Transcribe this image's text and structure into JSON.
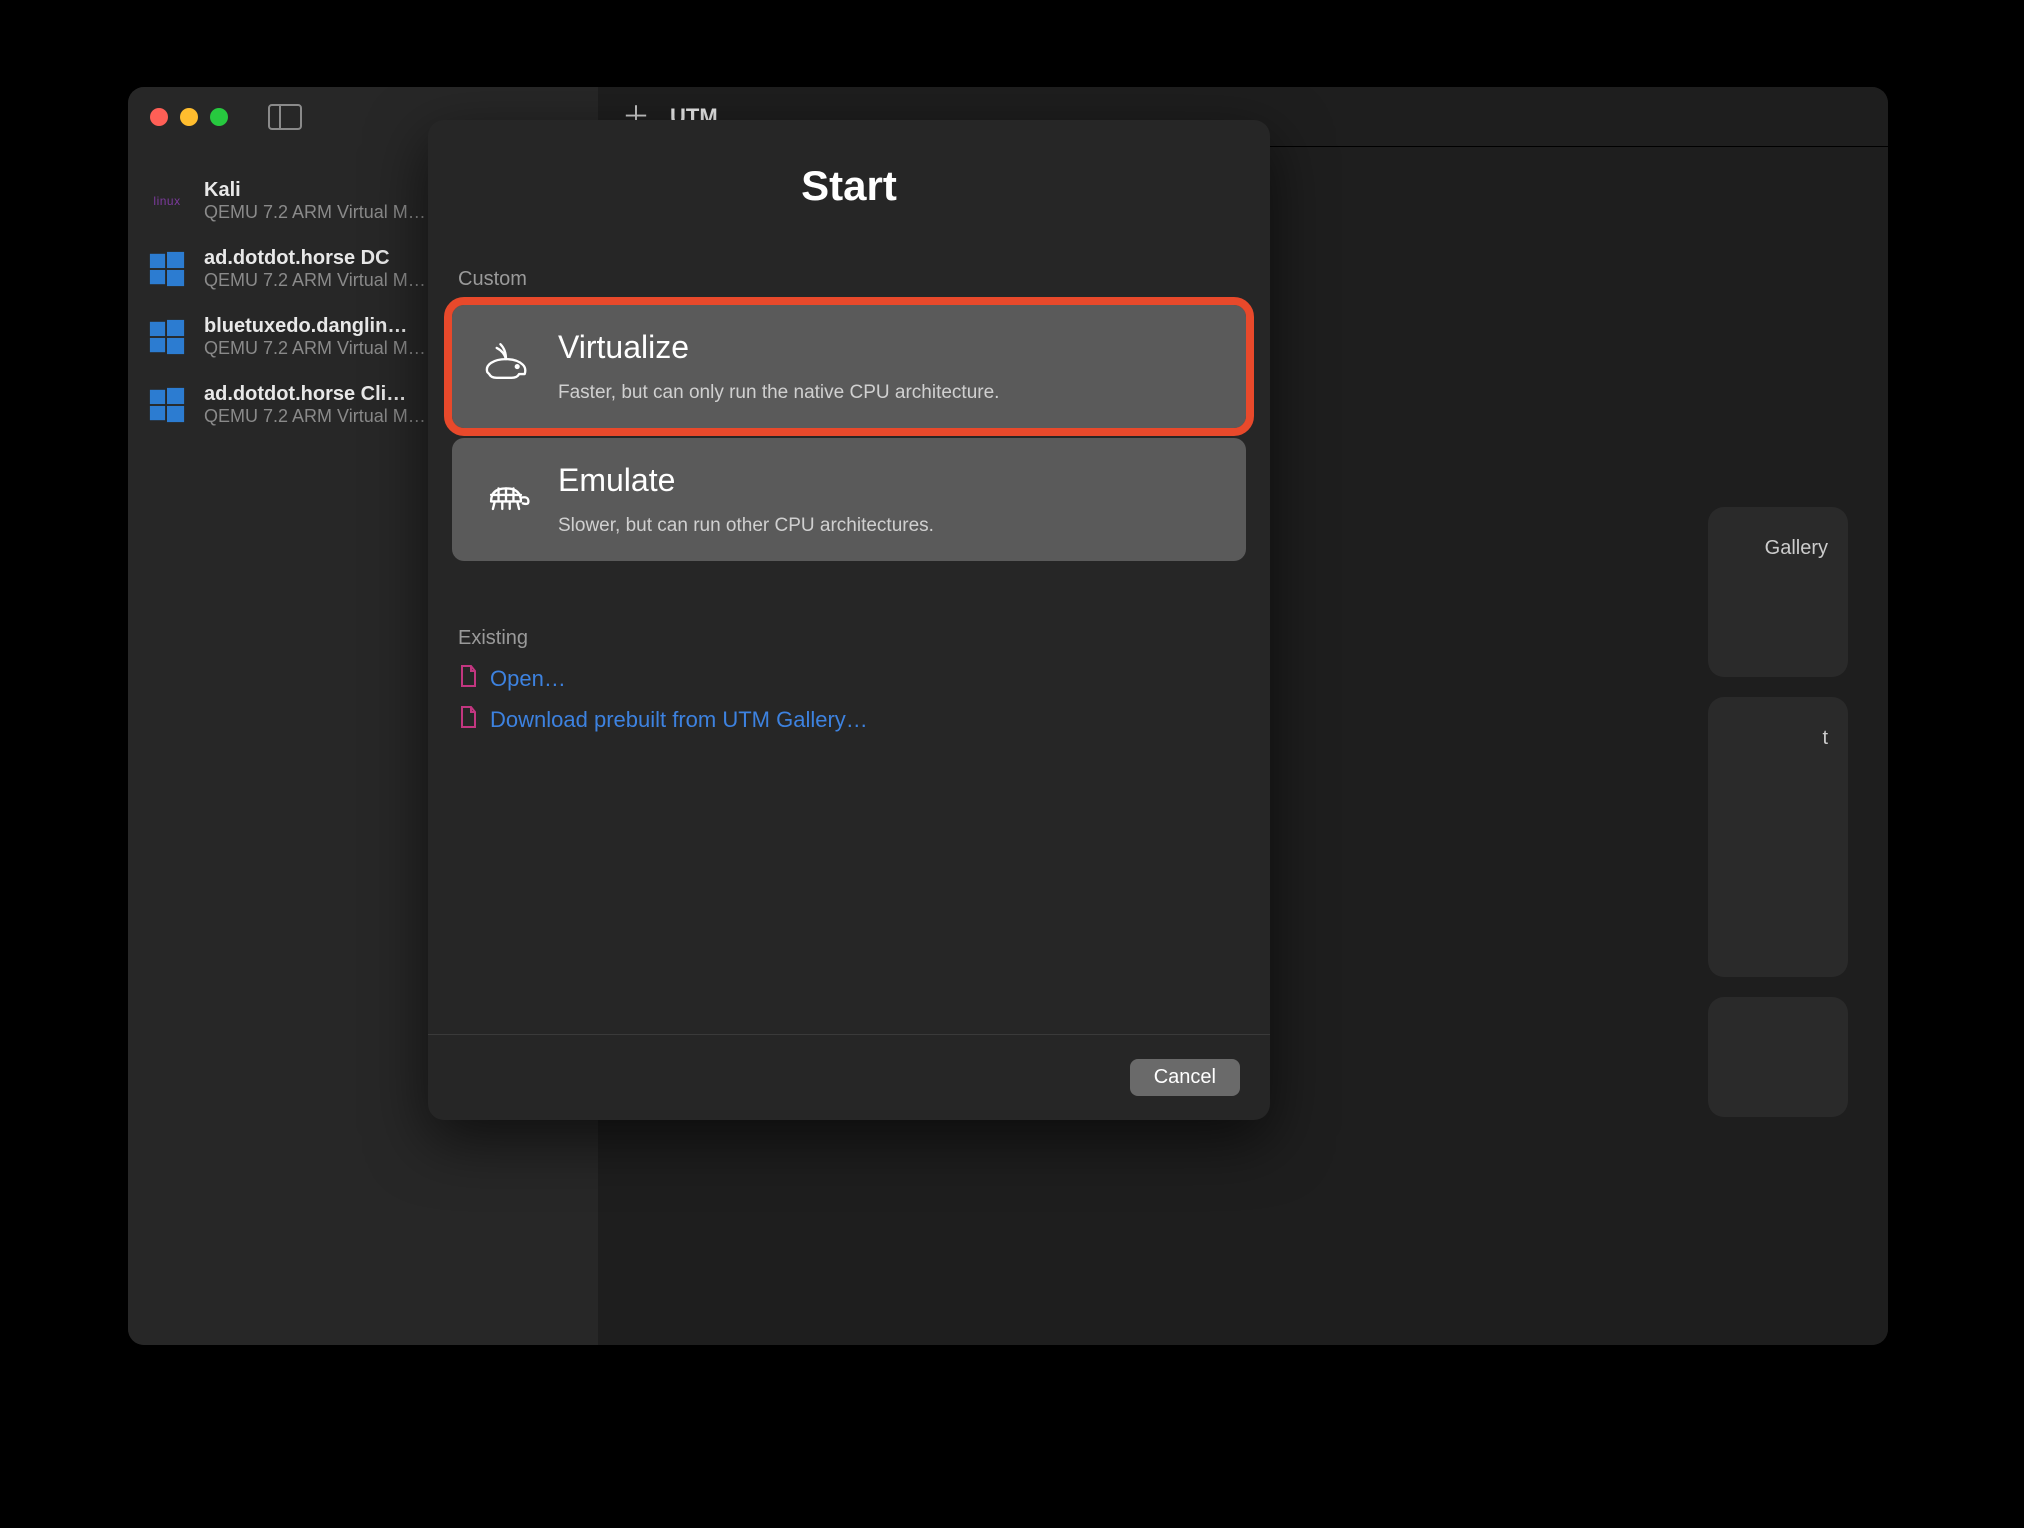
{
  "app": {
    "title": "UTM"
  },
  "sidebar": {
    "vms": [
      {
        "name": "Kali",
        "subtitle": "QEMU 7.2 ARM Virtual M…",
        "kind": "linux"
      },
      {
        "name": "ad.dotdot.horse DC",
        "subtitle": "QEMU 7.2 ARM Virtual M…",
        "kind": "windows"
      },
      {
        "name": "bluetuxedo.danglin…",
        "subtitle": "QEMU 7.2 ARM Virtual M…",
        "kind": "windows"
      },
      {
        "name": "ad.dotdot.horse Cli…",
        "subtitle": "QEMU 7.2 ARM Virtual M…",
        "kind": "windows"
      }
    ]
  },
  "background": {
    "card1": "Gallery",
    "card2": "t",
    "card3": ""
  },
  "modal": {
    "title": "Start",
    "custom_label": "Custom",
    "options": [
      {
        "title": "Virtualize",
        "desc": "Faster, but can only run the native CPU architecture.",
        "highlighted": true,
        "icon": "rabbit"
      },
      {
        "title": "Emulate",
        "desc": "Slower, but can run other CPU architectures.",
        "highlighted": false,
        "icon": "turtle"
      }
    ],
    "existing_label": "Existing",
    "links": [
      {
        "label": "Open…"
      },
      {
        "label": "Download prebuilt from UTM Gallery…"
      }
    ],
    "cancel_label": "Cancel"
  }
}
